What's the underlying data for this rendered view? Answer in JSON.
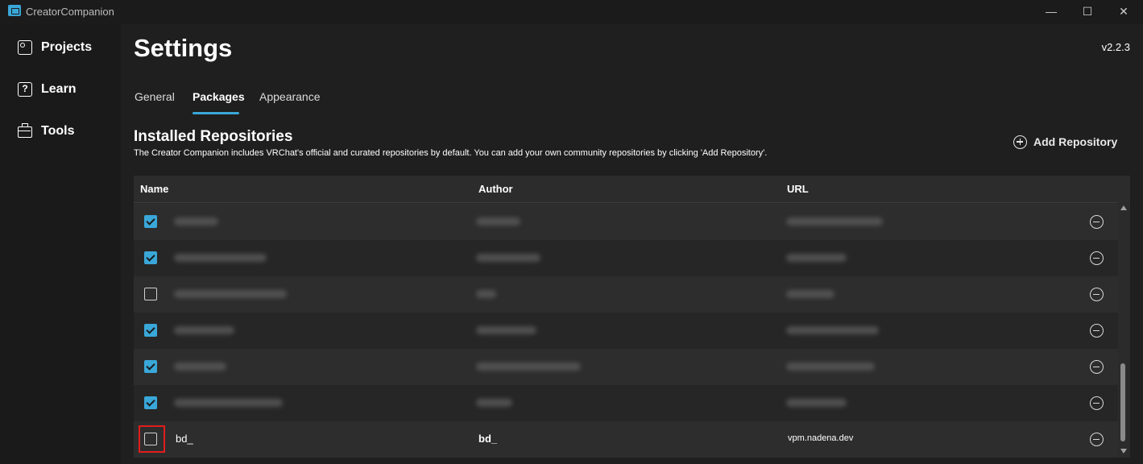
{
  "window": {
    "title": "CreatorCompanion",
    "minimize": "—",
    "maximize": "☐",
    "close": "✕"
  },
  "sidebar": {
    "items": [
      {
        "label": "Projects",
        "icon": "projects-grid-icon"
      },
      {
        "label": "Learn",
        "icon": "help-book-icon"
      },
      {
        "label": "Tools",
        "icon": "toolbox-icon"
      }
    ]
  },
  "page": {
    "title": "Settings",
    "version": "v2.2.3"
  },
  "tabs": [
    {
      "label": "General",
      "active": false
    },
    {
      "label": "Packages",
      "active": true
    },
    {
      "label": "Appearance",
      "active": false
    }
  ],
  "section": {
    "title": "Installed Repositories",
    "description": "The Creator Companion includes VRChat's official and curated repositories by default. You can add your own community repositories by clicking 'Add Repository'.",
    "add_button": "Add Repository"
  },
  "table": {
    "columns": [
      "Name",
      "Author",
      "URL"
    ],
    "rows": [
      {
        "checked": true,
        "name": "",
        "author": "",
        "url": "",
        "blurred": true
      },
      {
        "checked": true,
        "name": "",
        "author": "",
        "url": "",
        "blurred": true
      },
      {
        "checked": false,
        "name": "",
        "author": "",
        "url": "",
        "blurred": true
      },
      {
        "checked": true,
        "name": "",
        "author": "",
        "url": "",
        "blurred": true
      },
      {
        "checked": true,
        "name": "",
        "author": "",
        "url": "",
        "blurred": true
      },
      {
        "checked": true,
        "name": "",
        "author": "",
        "url": "",
        "blurred": true
      },
      {
        "checked": false,
        "name": "bd_",
        "author": "bd_",
        "url": "vpm.nadena.dev",
        "blurred": false
      }
    ]
  },
  "colors": {
    "accent": "#3aa7d9",
    "highlight": "#e11d1d",
    "background": "#1f1f1f"
  }
}
